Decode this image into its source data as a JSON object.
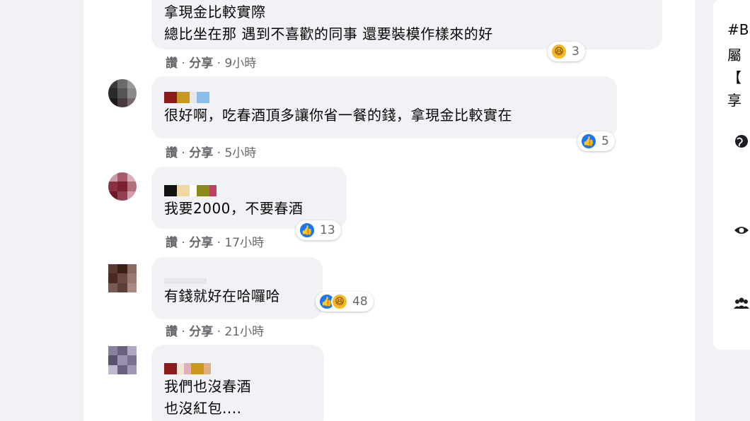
{
  "actions": {
    "like": "讚",
    "share": "分享",
    "sep": "·"
  },
  "comments": [
    {
      "lines": [
        "拿現金比較實際",
        "總比坐在那 遇到不喜歡的同事 還要裝模作樣來的好"
      ],
      "time": "9小時",
      "reactions": {
        "icons": [
          "haha-icon"
        ],
        "count": "3"
      }
    },
    {
      "lines": [
        "很好啊，吃春酒頂多讓你省一餐的錢，拿現金比較實在"
      ],
      "time": "5小時",
      "reactions": {
        "icons": [
          "like-icon"
        ],
        "count": "5"
      }
    },
    {
      "lines": [
        "我要2000，不要春酒"
      ],
      "time": "17小時",
      "reactions": {
        "icons": [
          "like-icon"
        ],
        "count": "13"
      }
    },
    {
      "lines": [
        "有錢就好在哈囉哈"
      ],
      "time": "21小時",
      "reactions": {
        "icons": [
          "like-icon",
          "haha-icon"
        ],
        "count": "48"
      }
    },
    {
      "lines": [
        "我們也沒春酒",
        "也沒紅包...."
      ],
      "time": "",
      "reactions": null
    }
  ],
  "sidebar": {
    "text_lines": [
      "#B",
      "屬",
      "【",
      "享"
    ],
    "icons": [
      "globe-icon",
      "eye-icon",
      "group-icon"
    ]
  },
  "colors": {
    "page_bg": "#f0f2f5",
    "bubble_bg": "#f0f2f5",
    "like_blue": "#1877f2",
    "haha_yellow": "#f7b928"
  }
}
